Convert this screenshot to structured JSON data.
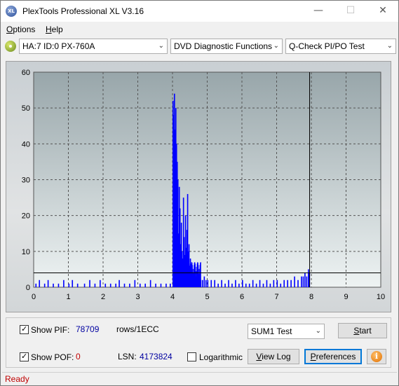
{
  "window": {
    "title": "PlexTools Professional XL V3.16",
    "logo_text": "XL",
    "controls": {
      "minimize": "—",
      "maximize": "☐",
      "close": "✕"
    }
  },
  "menu": {
    "options": {
      "first": "O",
      "rest": "ptions"
    },
    "help": {
      "first": "H",
      "rest": "elp"
    }
  },
  "selectors": {
    "drive": "HA:7 ID:0  PX-760A",
    "function": "DVD Diagnostic Functions",
    "test": "Q-Check PI/PO Test"
  },
  "chart_data": {
    "type": "bar",
    "xlim": [
      0,
      10
    ],
    "ylim": [
      0,
      60
    ],
    "x_ticks": [
      "0",
      "1",
      "2",
      "3",
      "4",
      "5",
      "6",
      "7",
      "8",
      "9",
      "10"
    ],
    "y_ticks": [
      "10",
      "20",
      "30",
      "40",
      "50",
      "60"
    ],
    "threshold": 4,
    "cursor_x": 7.95,
    "grid": true,
    "colors": {
      "bars": "#0000ff",
      "line": "#000000",
      "plot_top": "#98a6aa",
      "plot_bottom": "#eef3f3"
    },
    "pif_x": [
      0.05,
      0.15,
      0.3,
      0.4,
      0.55,
      0.7,
      0.85,
      1.0,
      1.1,
      1.25,
      1.45,
      1.6,
      1.75,
      1.9,
      2.05,
      2.2,
      2.35,
      2.45,
      2.6,
      2.75,
      2.9,
      3.05,
      3.2,
      3.35,
      3.5,
      3.65,
      3.8,
      3.92,
      4.0,
      4.02,
      4.04,
      4.06,
      4.08,
      4.1,
      4.12,
      4.14,
      4.16,
      4.18,
      4.2,
      4.22,
      4.24,
      4.26,
      4.28,
      4.3,
      4.32,
      4.34,
      4.36,
      4.38,
      4.4,
      4.42,
      4.44,
      4.46,
      4.48,
      4.5,
      4.52,
      4.54,
      4.56,
      4.58,
      4.6,
      4.62,
      4.64,
      4.66,
      4.68,
      4.7,
      4.75,
      4.8,
      4.85,
      4.9,
      4.95,
      5.0,
      5.1,
      5.2,
      5.3,
      5.4,
      5.5,
      5.6,
      5.7,
      5.8,
      5.9,
      6.0,
      6.1,
      6.2,
      6.3,
      6.4,
      6.5,
      6.6,
      6.7,
      6.8,
      6.9,
      7.0,
      7.1,
      7.2,
      7.3,
      7.4,
      7.5,
      7.6,
      7.7,
      7.75,
      7.8,
      7.85,
      7.9,
      7.93
    ],
    "pif_y": [
      1,
      2,
      1,
      2,
      1,
      1,
      2,
      1,
      2,
      1,
      1,
      2,
      1,
      2,
      1,
      1,
      1,
      2,
      1,
      1,
      2,
      1,
      1,
      2,
      1,
      1,
      1,
      1,
      52,
      48,
      54,
      44,
      50,
      40,
      35,
      30,
      15,
      28,
      22,
      12,
      18,
      10,
      8,
      25,
      14,
      9,
      20,
      11,
      16,
      26,
      10,
      12,
      6,
      8,
      5,
      5,
      4,
      4,
      3,
      3,
      3,
      2,
      3,
      2,
      3,
      2,
      2,
      3,
      2,
      2,
      2,
      2,
      1,
      2,
      1,
      2,
      1,
      2,
      1,
      2,
      1,
      1,
      2,
      1,
      2,
      1,
      2,
      1,
      2,
      2,
      1,
      2,
      2,
      2,
      3,
      2,
      3,
      3,
      4,
      3,
      5,
      4
    ]
  },
  "controls": {
    "show_pif_label": "Show PIF:",
    "pif_value": "78709",
    "pif_unit": "rows/1ECC",
    "show_pof_label": "Show POF:",
    "pof_value": "0",
    "lsn_label": "LSN:",
    "lsn_value": "4173824",
    "logarithmic_label": "Logarithmic",
    "test_select": "SUM1 Test",
    "start_button": {
      "first": "S",
      "rest": "tart"
    },
    "view_log_button": {
      "first": "V",
      "rest": "iew Log"
    },
    "preferences_button": {
      "first": "P",
      "rest": "references"
    },
    "info_icon_glyph": "i",
    "check_glyph": "✓",
    "dropdown_glyph": "⌄"
  },
  "status": {
    "text": "Ready"
  }
}
